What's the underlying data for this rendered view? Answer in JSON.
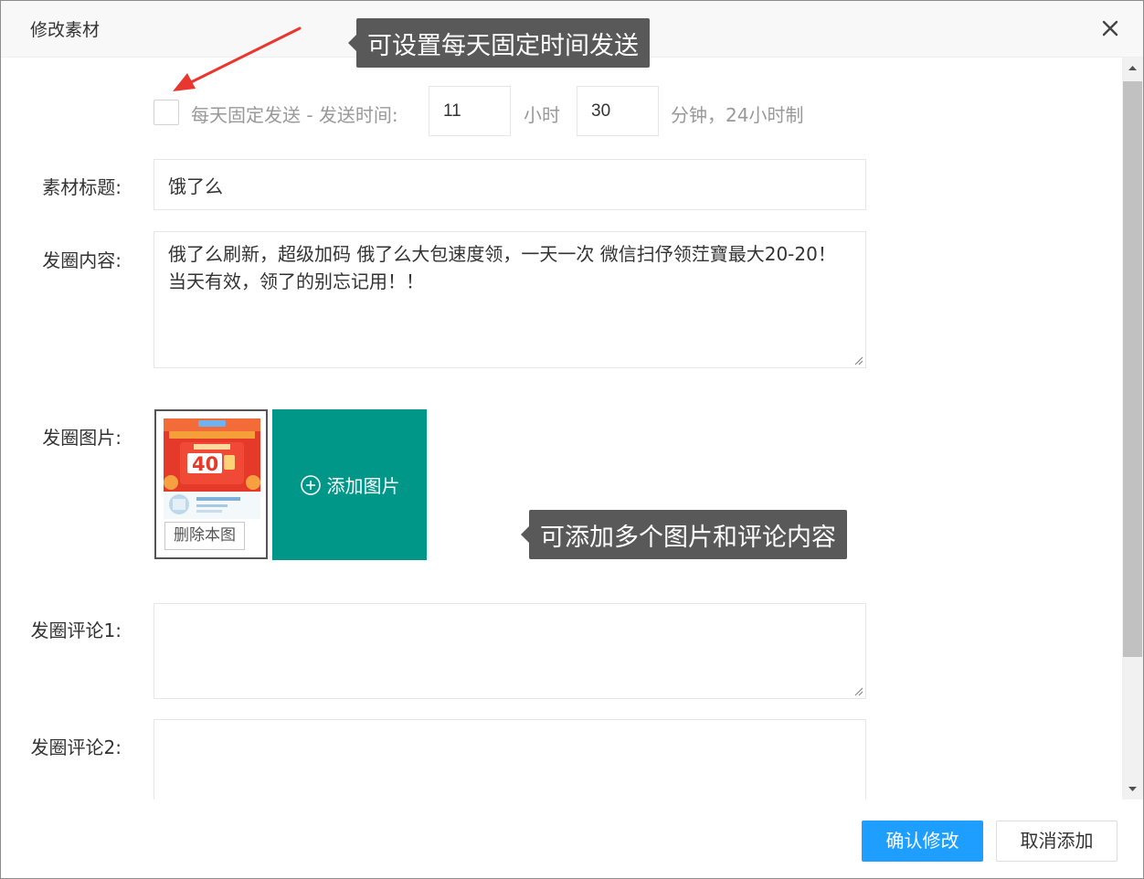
{
  "dialog": {
    "title": "修改素材"
  },
  "schedule": {
    "checkbox_label": "每天固定发送 - 发送时间:",
    "hour_value": "11",
    "hour_unit": "小时",
    "minute_value": "30",
    "minute_unit": "分钟，24小时制",
    "checked": false
  },
  "form": {
    "title_label": "素材标题:",
    "title_value": "饿了么",
    "content_label": "发圈内容:",
    "content_value": "俄了么刷新，超级加码 俄了么大包速度领，一天一次 微信扫伃领茳寶最大20-20！ 当天有效，领了的别忘记用！！",
    "images_label": "发圈图片:",
    "delete_image_label": "删除本图",
    "add_image_label": "添加图片",
    "comment1_label": "发圈评论1:",
    "comment1_value": "",
    "comment2_label": "发圈评论2:",
    "comment2_value": ""
  },
  "callouts": {
    "top": "可设置每天固定时间发送",
    "images": "可添加多个图片和评论内容"
  },
  "footer": {
    "confirm_label": "确认修改",
    "cancel_label": "取消添加"
  },
  "colors": {
    "primary": "#1e9fff",
    "add_image": "#009688",
    "callout": "#595959",
    "annotation_arrow": "#e8372f"
  }
}
